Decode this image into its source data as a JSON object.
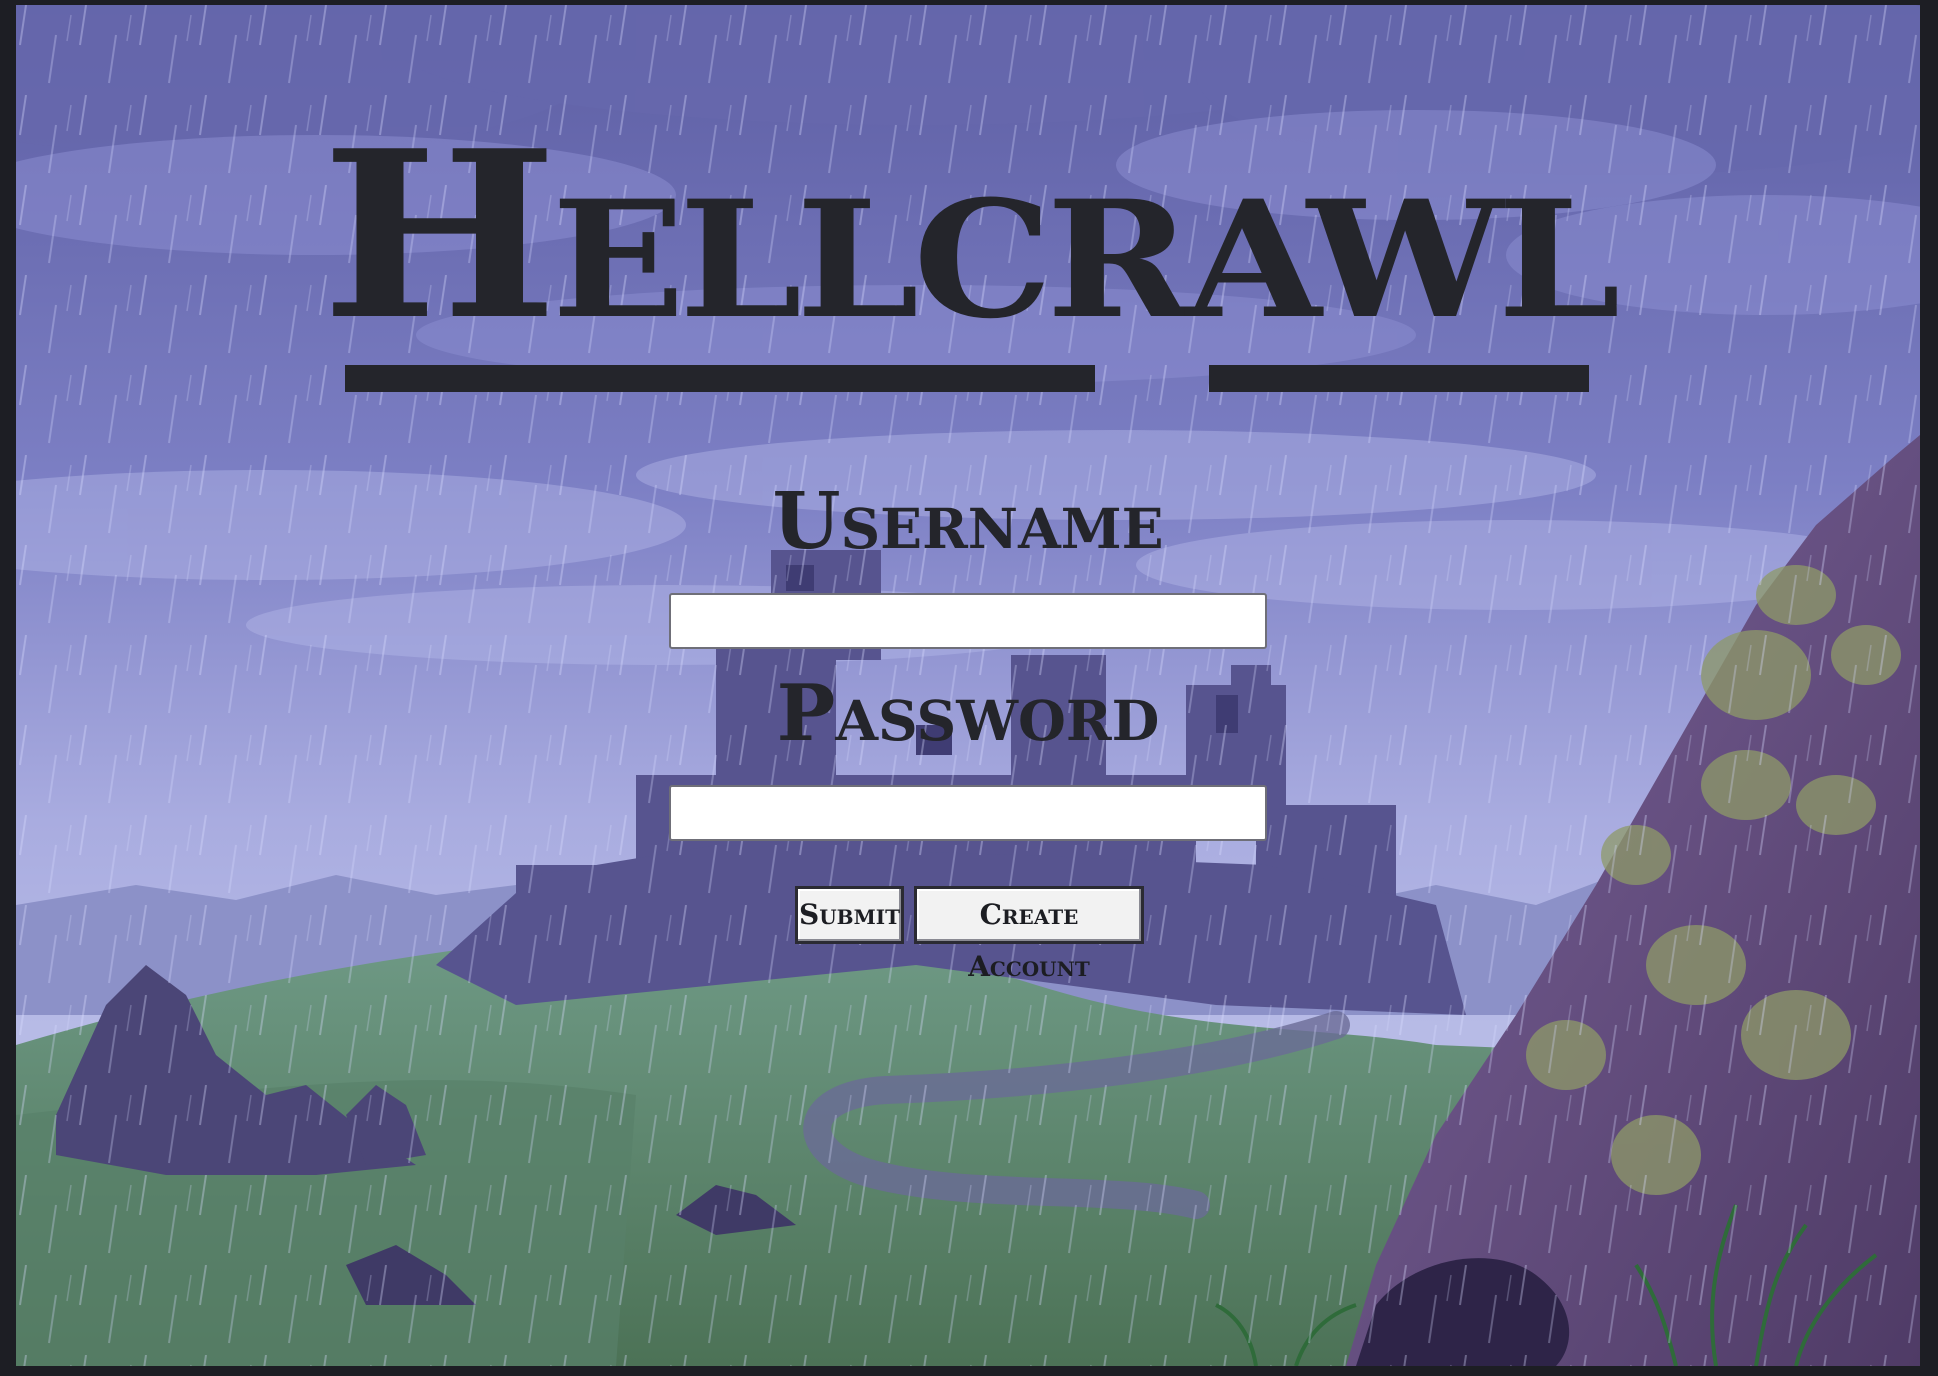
{
  "title": "Hellcrawl",
  "form": {
    "username_label": "Username",
    "username_value": "",
    "password_label": "Password",
    "password_value": "",
    "submit_label": "Submit",
    "create_account_label": "Create Account"
  },
  "colors": {
    "text": "#24252b",
    "sky": "#6d6fb8",
    "hills": "#5e8a6f",
    "castle": "#55528f",
    "rock": "#6f5688",
    "moss": "#8e9a68"
  }
}
